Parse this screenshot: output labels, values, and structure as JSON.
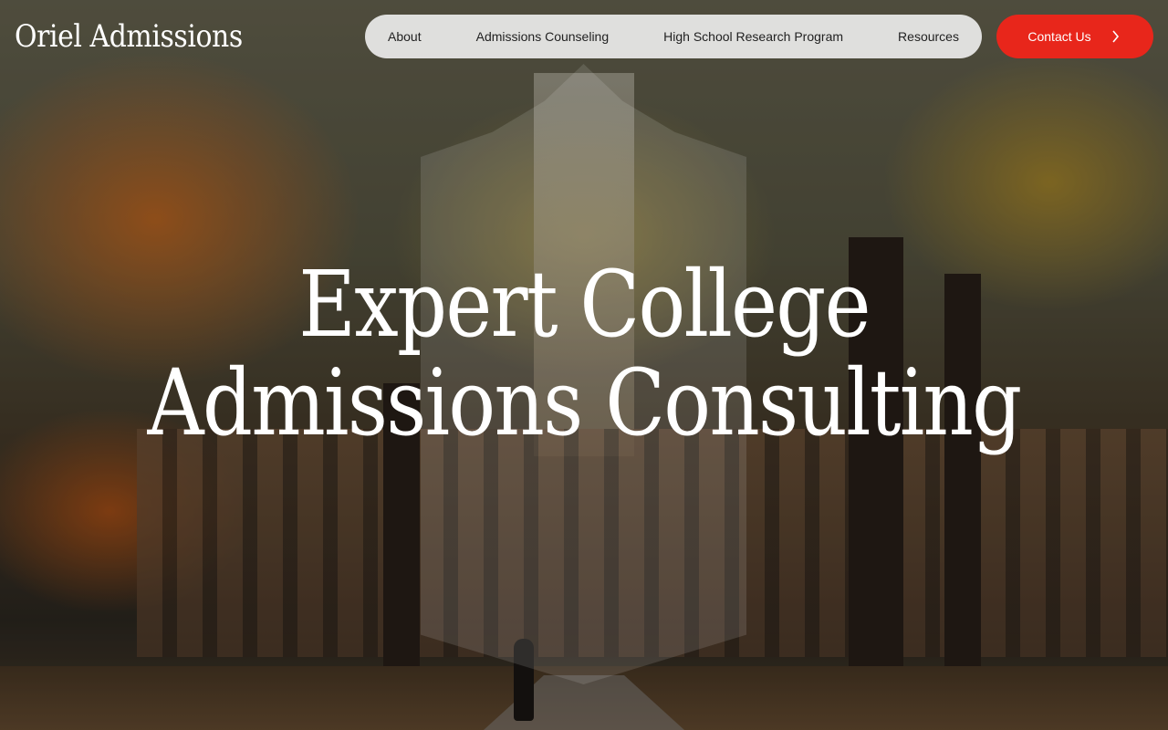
{
  "brand": {
    "logo_text": "Oriel Admissions"
  },
  "nav": {
    "items": [
      {
        "label": "About"
      },
      {
        "label": "Admissions Counseling"
      },
      {
        "label": "High School Research Program"
      },
      {
        "label": "Resources"
      }
    ]
  },
  "cta": {
    "label": "Contact Us",
    "icon": "chevron-right-icon",
    "color": "#e8261b"
  },
  "hero": {
    "headline_line1": "Expert College",
    "headline_line2": "Admissions Consulting"
  }
}
